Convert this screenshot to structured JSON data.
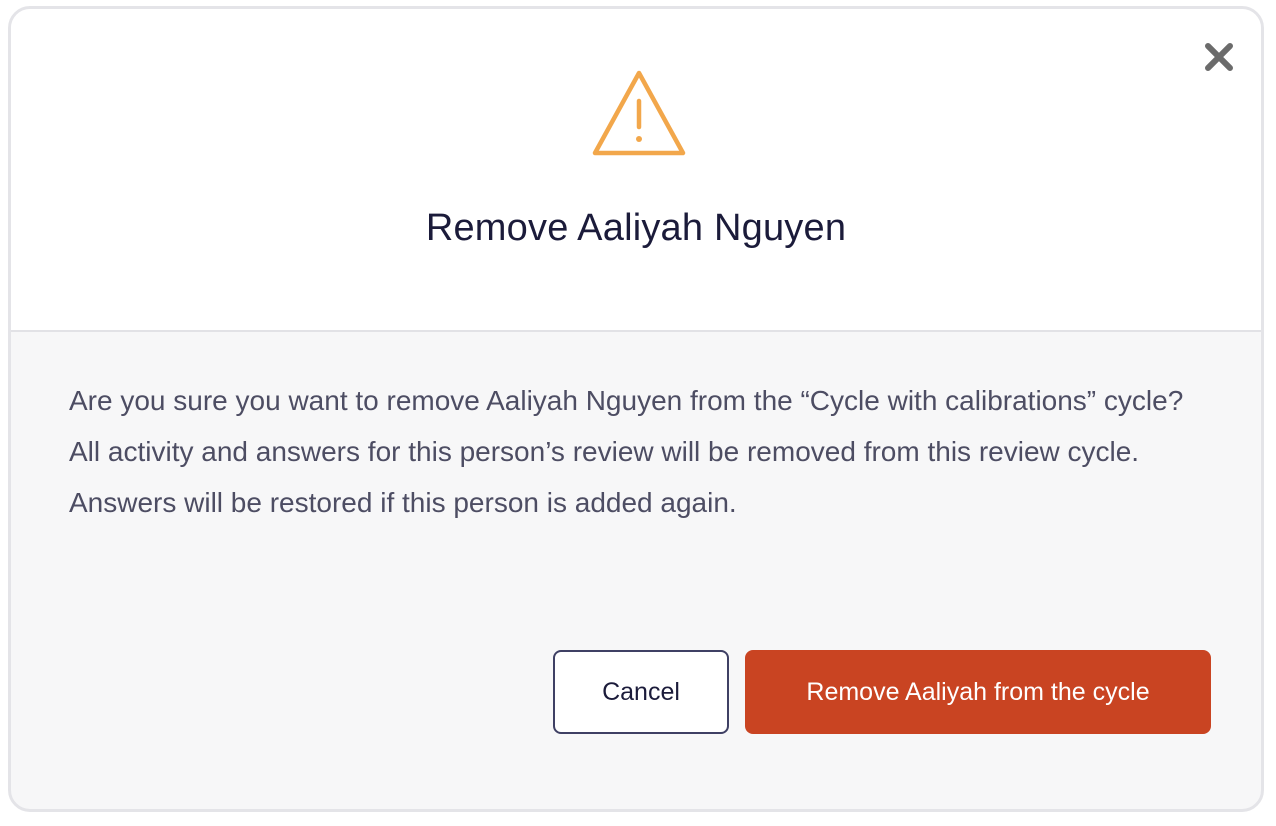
{
  "dialog": {
    "title": "Remove Aaliyah Nguyen",
    "message": "Are you sure you want to remove Aaliyah Nguyen from the “Cycle with calibrations” cycle? All activity and answers for this person’s review will be removed from this review cycle. Answers will be restored if this person is added again.",
    "warning_icon": "warning-triangle-icon",
    "close_icon": "close-icon",
    "cancel_label": "Cancel",
    "confirm_label": "Remove Aaliyah from the cycle"
  },
  "colors": {
    "warning": "#F2A74B",
    "danger": "#C94422",
    "title_text": "#1B1B3A",
    "body_text": "#4D4D63",
    "footer_bg": "#F7F7F8"
  }
}
